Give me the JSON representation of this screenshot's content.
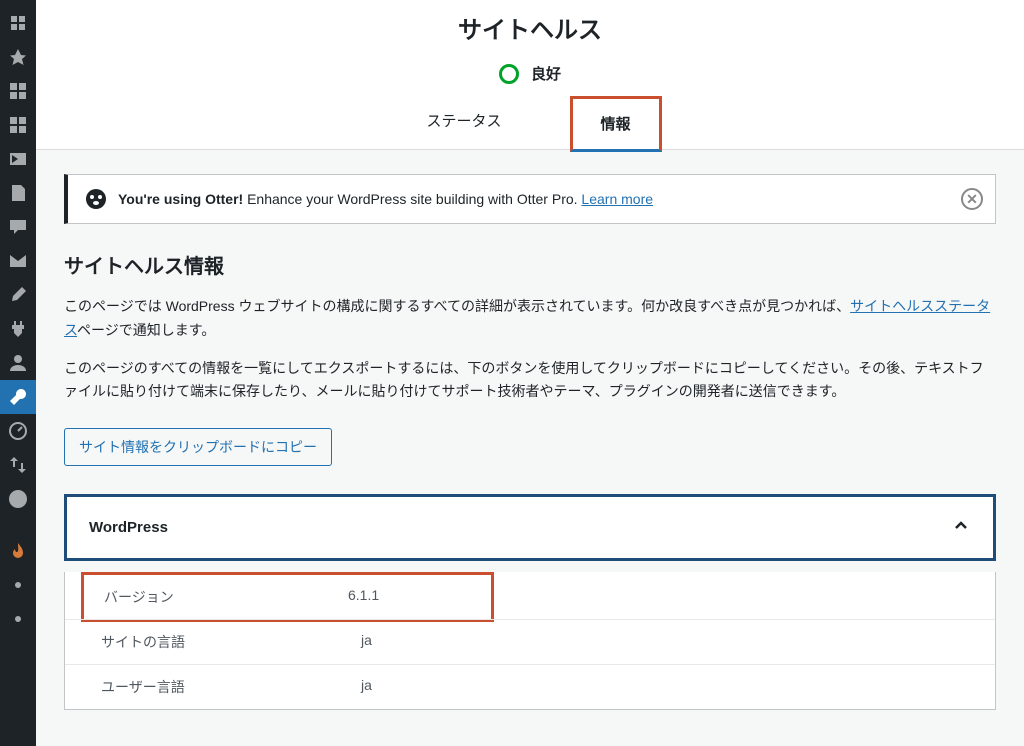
{
  "header": {
    "title": "サイトヘルス",
    "status_label": "良好",
    "tabs": {
      "status": "ステータス",
      "info": "情報"
    }
  },
  "notice": {
    "strong": "You're using Otter!",
    "rest": " Enhance your WordPress site building with Otter Pro. ",
    "link": "Learn more"
  },
  "section": {
    "heading": "サイトヘルス情報",
    "desc1_pre": "このページでは WordPress ウェブサイトの構成に関するすべての詳細が表示されています。何か改良すべき点が見つかれば、",
    "desc1_link": "サイトヘルスステータス",
    "desc1_post": "ページで通知します。",
    "desc2": "このページのすべての情報を一覧にしてエクスポートするには、下のボタンを使用してクリップボードにコピーしてください。その後、テキストファイルに貼り付けて端末に保存したり、メールに貼り付けてサポート技術者やテーマ、プラグインの開発者に送信できます。",
    "copy_button": "サイト情報をクリップボードにコピー"
  },
  "accordion": {
    "title": "WordPress",
    "rows": [
      {
        "label": "バージョン",
        "value": "6.1.1"
      },
      {
        "label": "サイトの言語",
        "value": "ja"
      },
      {
        "label": "ユーザー言語",
        "value": "ja"
      }
    ]
  }
}
